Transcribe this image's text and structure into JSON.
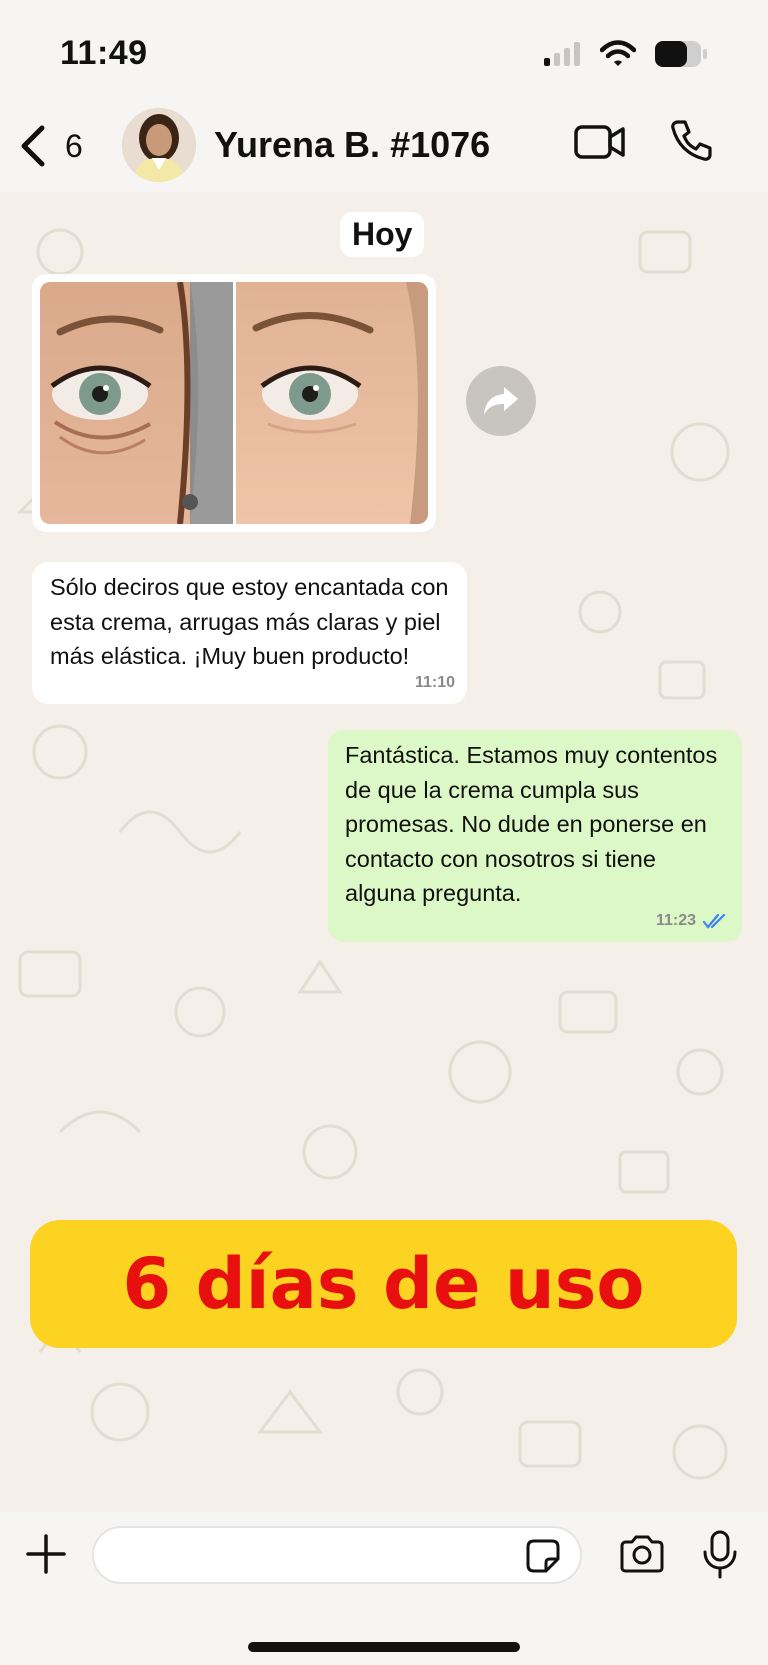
{
  "status_bar": {
    "time": "11:49"
  },
  "header": {
    "back_count": "6",
    "contact_name": "Yurena B. #1076"
  },
  "chat": {
    "date_label": "Hoy",
    "messages": [
      {
        "type": "image",
        "description_icon": "before-after-eye-photo"
      },
      {
        "type": "incoming",
        "text": "Sólo deciros que estoy encantada con esta crema, arrugas más claras y piel más elástica. ¡Muy buen producto!",
        "time": "11:10"
      },
      {
        "type": "outgoing",
        "text": "Fantástica. Estamos muy contentos de que la crema cumpla sus promesas. No dude en ponerse en contacto con nosotros si tiene alguna pregunta.",
        "time": "11:23",
        "read": true
      }
    ]
  },
  "banner": {
    "text": "6 días de uso"
  },
  "composer": {
    "placeholder": ""
  },
  "colors": {
    "outgoing_bubble": "#dbf8c6",
    "banner_bg": "#fcd321",
    "banner_text": "#e8100f",
    "read_ticks": "#3b82f6"
  }
}
